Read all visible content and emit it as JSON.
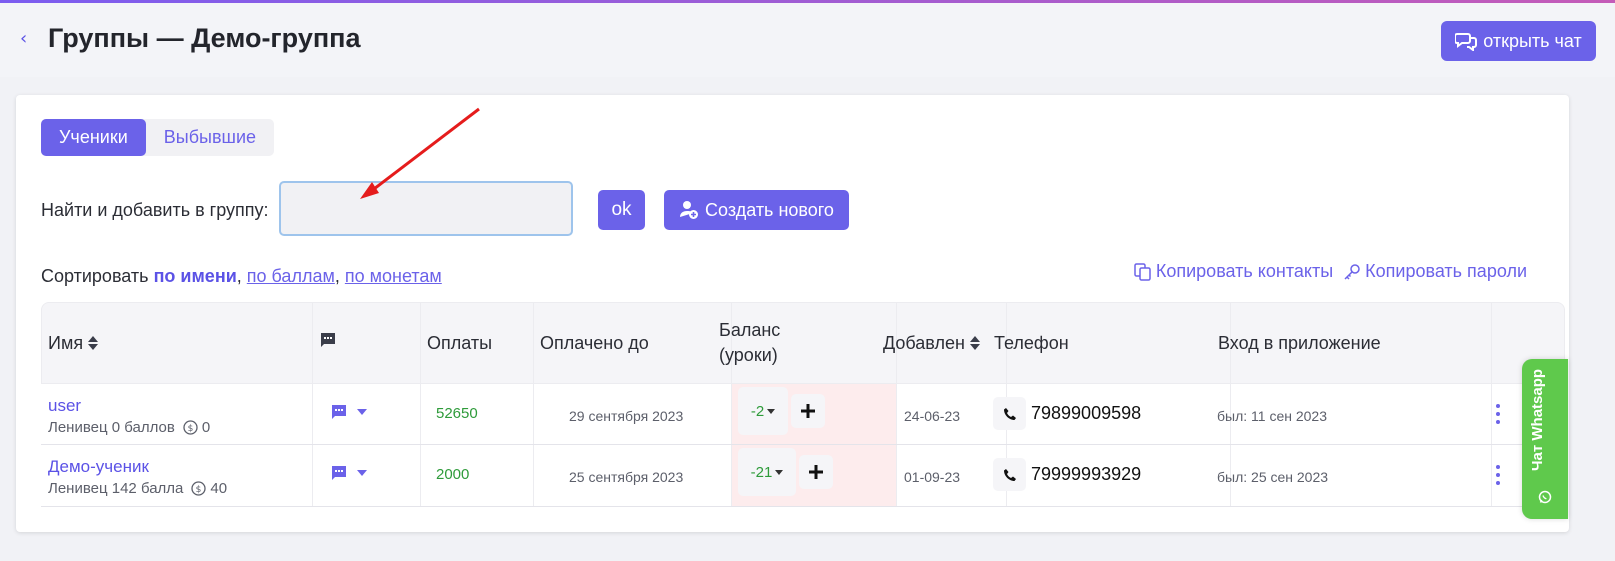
{
  "header": {
    "title": "Группы — Демо-группа",
    "chat_button": "открыть чат"
  },
  "tabs": [
    {
      "label": "Ученики",
      "active": true
    },
    {
      "label": "Выбывшие",
      "active": false
    }
  ],
  "search": {
    "label": "Найти и добавить в группу:",
    "value": "",
    "ok_label": "ok",
    "create_label": "Создать нового"
  },
  "sort": {
    "prefix": "Сортировать",
    "options": [
      "по имени",
      "по баллам",
      "по монетам"
    ],
    "active": "по имени"
  },
  "copy": {
    "contacts": "Копировать контакты",
    "passwords": "Копировать пароли"
  },
  "table": {
    "columns": [
      "Имя",
      "",
      "Оплаты",
      "Оплачено до",
      "Баланс (уроки)",
      "Добавлен",
      "Телефон",
      "Вход в приложение",
      ""
    ],
    "balance_header": [
      "Баланс",
      "(уроки)"
    ],
    "rows": [
      {
        "name": "user",
        "sub": "Ленивец 0 баллов",
        "coins": "0",
        "payments": "52650",
        "paid_until": "29 сентября 2023",
        "balance": "-2",
        "added": "24-06-23",
        "phone": "79899009598",
        "login": "был: 11 сен 2023"
      },
      {
        "name": "Демо-ученик",
        "sub": "Ленивец 142 балла",
        "coins": "40",
        "payments": "2000",
        "paid_until": "25 сентября 2023",
        "balance": "-21",
        "added": "01-09-23",
        "phone": "79999993929",
        "login": "был: 25 сен 2023"
      }
    ]
  },
  "whatsapp": {
    "label": "Чат Whatsapp"
  },
  "colors": {
    "accent": "#6b62e9",
    "green": "#2e9b3a",
    "whatsapp": "#5fc94c",
    "annotation_arrow": "#e51c1c"
  }
}
